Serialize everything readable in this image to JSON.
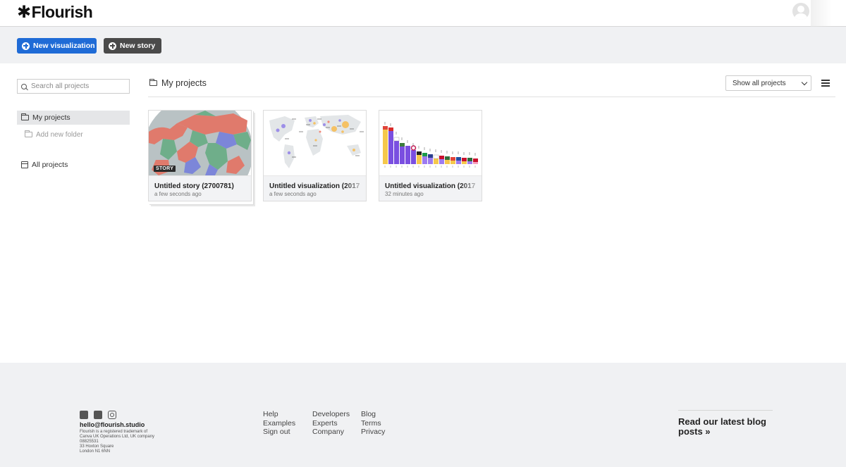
{
  "header": {
    "logo_star": "✱",
    "logo_text": "Flourish"
  },
  "actions": {
    "new_visualization": "New visualization",
    "new_story": "New story"
  },
  "sidebar": {
    "search_placeholder": "Search all projects",
    "my_projects": "My projects",
    "add_folder": "Add new folder",
    "all_projects": "All projects"
  },
  "main": {
    "title": "My projects",
    "filter_selected": "Show all projects",
    "cards": [
      {
        "title": "Untitled story (2700781)",
        "time": "a few seconds ago",
        "badge": "STORY",
        "type": "story-map"
      },
      {
        "title": "Untitled visualization (2017",
        "time": "a few seconds ago",
        "type": "world-map"
      },
      {
        "title": "Untitled visualization (2017",
        "time": "32 minutes ago",
        "type": "bar-chart"
      }
    ]
  },
  "colors": {
    "primary_button": "#1f6bd6",
    "secondary_button": "#4a4a4a",
    "footer_bg": "#f0f1f3"
  },
  "footer": {
    "email": "hello@flourish.studio",
    "legal_1": "Flourish is a registered trademark of",
    "legal_2": "Canva UK Operations Ltd, UK company",
    "legal_3": "08825531",
    "legal_4": "33 Hoxton Square",
    "legal_5": "London N1 6NN",
    "col1": [
      "Help",
      "Examples",
      "Sign out"
    ],
    "col2": [
      "Developers",
      "Experts",
      "Company"
    ],
    "col3": [
      "Blog",
      "Terms",
      "Privacy"
    ],
    "blog_cta_1": "Read our latest blog",
    "blog_cta_2": "posts »"
  }
}
